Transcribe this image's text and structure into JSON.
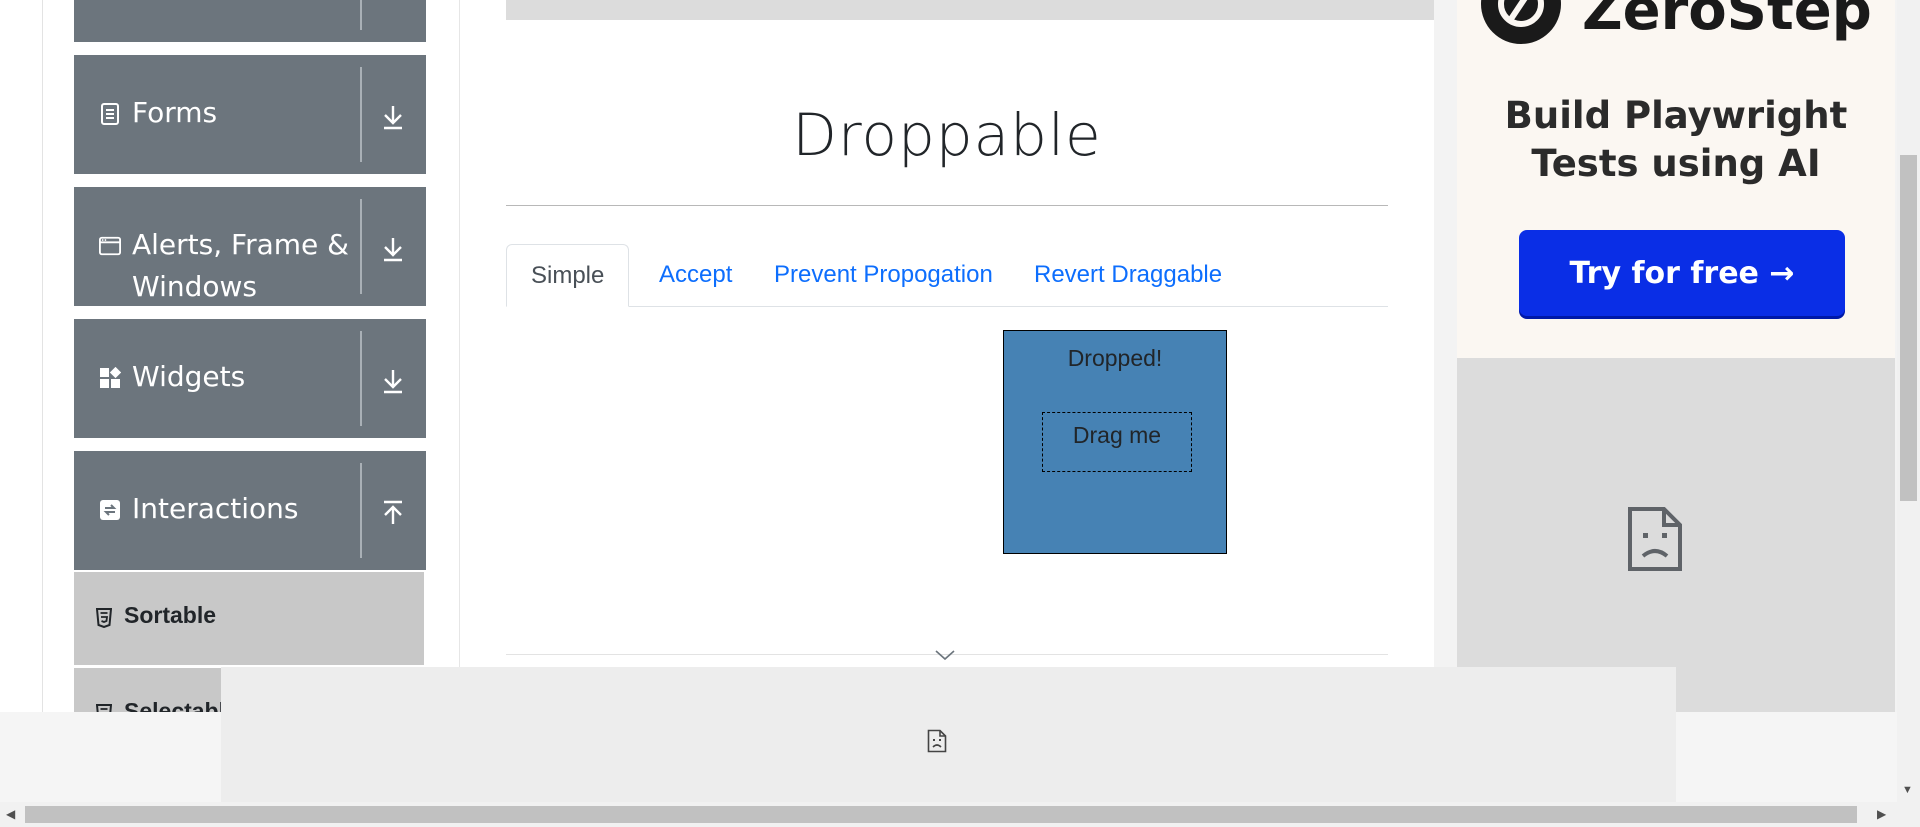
{
  "sidebar": {
    "groups": [
      {
        "label": "",
        "icon": "elements-icon",
        "expanded": false
      },
      {
        "label": "Forms",
        "icon": "form-document-icon",
        "expanded": false
      },
      {
        "label_line1": "Alerts, Frame &",
        "label_line2": "Windows",
        "icon": "window-icon",
        "expanded": false
      },
      {
        "label": "Widgets",
        "icon": "widgets-grid-icon",
        "expanded": false
      },
      {
        "label": "Interactions",
        "icon": "interactions-swap-icon",
        "expanded": true
      }
    ],
    "items": [
      {
        "label": "Sortable",
        "icon": "html5-icon",
        "active": true
      },
      {
        "label": "Selectable",
        "icon": "html5-icon",
        "active": false
      }
    ]
  },
  "main": {
    "title": "Droppable",
    "tabs": [
      {
        "label": "Simple",
        "active": true
      },
      {
        "label": "Accept",
        "active": false
      },
      {
        "label": "Prevent Propogation",
        "active": false
      },
      {
        "label": "Revert Draggable",
        "active": false
      }
    ],
    "droppable": {
      "label": "Dropped!",
      "color": "#4682b4"
    },
    "draggable": {
      "label": "Drag me"
    }
  },
  "ad": {
    "brand": "ZeroStep",
    "headline_line1": "Build Playwright",
    "headline_line2": "Tests using AI",
    "cta": "Try for free →",
    "cta_color": "#0a2ee6",
    "broken_image_icon": "broken-image-icon"
  },
  "colors": {
    "sidebar_group_bg": "#6c757d",
    "sidebar_active_item_bg": "#c8c8c8",
    "tab_link": "#0d6efd"
  }
}
